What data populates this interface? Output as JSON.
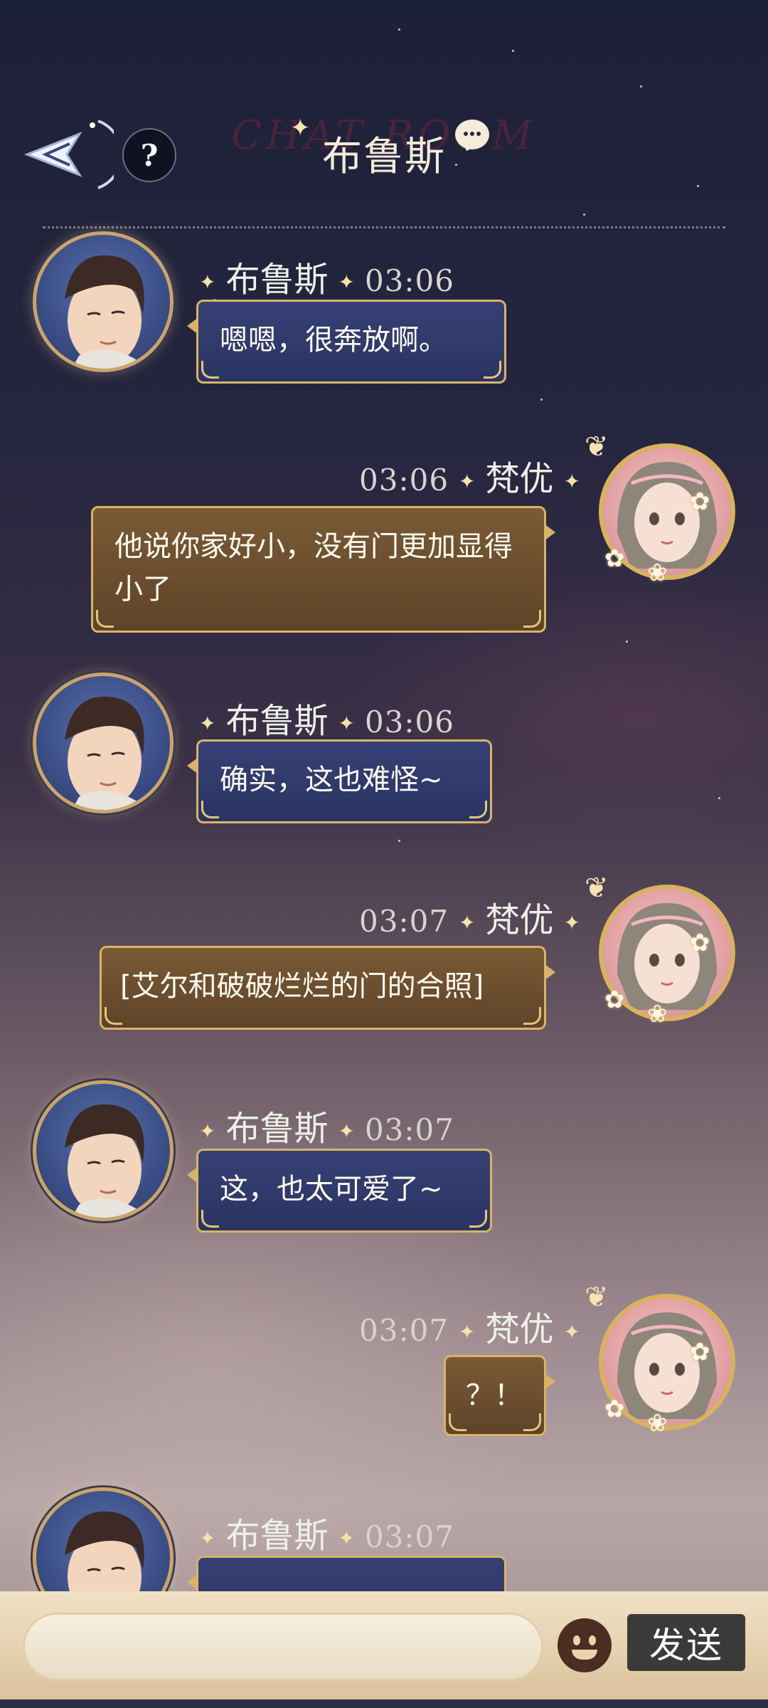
{
  "header": {
    "title": "布鲁斯",
    "watermark": "CHAT ROOM",
    "help_label": "?"
  },
  "messages": [
    {
      "sender": "布鲁斯",
      "time": "03:06",
      "text": "嗯嗯，很奔放啊。",
      "side": "left"
    },
    {
      "sender": "梵优",
      "time": "03:06",
      "text": "他说你家好小，没有门更加显得小了",
      "side": "right"
    },
    {
      "sender": "布鲁斯",
      "time": "03:06",
      "text": "确实，这也难怪~",
      "side": "left"
    },
    {
      "sender": "梵优",
      "time": "03:07",
      "text": "[艾尔和破破烂烂的门的合照]",
      "side": "right"
    },
    {
      "sender": "布鲁斯",
      "time": "03:07",
      "text": "这，也太可爱了~",
      "side": "left"
    },
    {
      "sender": "梵优",
      "time": "03:07",
      "text": "？！",
      "side": "right"
    },
    {
      "sender": "布鲁斯",
      "time": "03:07",
      "text": "",
      "side": "left"
    }
  ],
  "composer": {
    "input_value": "",
    "send_label": "发送"
  },
  "colors": {
    "accent_gold": "#d8b468",
    "bubble_left": "#2f3a6b",
    "bubble_right": "#6c4f30",
    "send_button": "#3c3a38"
  },
  "icons": [
    "back-arrow-icon",
    "help-icon",
    "chat-bubble-icon",
    "emoji-icon"
  ]
}
